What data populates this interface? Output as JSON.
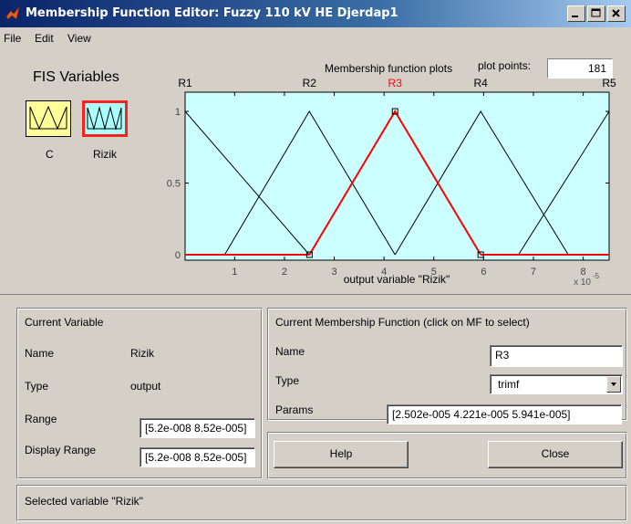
{
  "window": {
    "title": "Membership Function Editor: Fuzzy 110 kV HE Djerdap1",
    "icon": "matlab-icon",
    "buttons": [
      "minimize",
      "maximize",
      "close"
    ]
  },
  "menu": {
    "items": [
      "File",
      "Edit",
      "View"
    ]
  },
  "fis_variables": {
    "title": "FIS Variables",
    "variables": [
      {
        "name": "C",
        "selected": false,
        "fill": "#ffff99"
      },
      {
        "name": "Rizik",
        "selected": true,
        "fill": "#aaffff"
      }
    ],
    "selected_border": "#ff2020"
  },
  "plot_header": {
    "title": "Membership function plots",
    "plot_points_label": "plot points:",
    "plot_points_value": "181"
  },
  "chart_data": {
    "type": "line",
    "xlabel": "output variable \"Rizik\"",
    "x_multiplier": "x 10",
    "x_multiplier_exponent": "-5",
    "xlim": [
      0.0052,
      8.52
    ],
    "ylim": [
      0,
      1
    ],
    "x_ticks": [
      "1",
      "2",
      "3",
      "4",
      "5",
      "6",
      "7",
      "8"
    ],
    "y_ticks": [
      "0",
      "0.5",
      "1"
    ],
    "background": "#ccffff",
    "line_color": "#000000",
    "selected_color": "#ff0000",
    "series": [
      {
        "name": "R1",
        "x": [
          0.0052,
          0.0052,
          2.5
        ],
        "y": [
          0,
          1,
          0
        ]
      },
      {
        "name": "R2",
        "x": [
          0.8,
          2.5,
          4.221
        ],
        "y": [
          0,
          1,
          0
        ]
      },
      {
        "name": "R3",
        "x": [
          2.502,
          4.221,
          5.941
        ],
        "y": [
          0,
          1,
          0
        ],
        "selected": true
      },
      {
        "name": "R4",
        "x": [
          4.221,
          5.941,
          7.7
        ],
        "y": [
          0,
          1,
          0
        ]
      },
      {
        "name": "R5",
        "x": [
          6.7,
          8.52,
          8.52
        ],
        "y": [
          0,
          1,
          0
        ]
      }
    ]
  },
  "current_variable": {
    "title": "Current Variable",
    "name_label": "Name",
    "name_value": "Rizik",
    "type_label": "Type",
    "type_value": "output",
    "range_label": "Range",
    "range_value": "[5.2e-008 8.52e-005]",
    "display_range_label": "Display Range",
    "display_range_value": "[5.2e-008 8.52e-005]"
  },
  "current_mf": {
    "title": "Current Membership Function (click on MF to select)",
    "name_label": "Name",
    "name_value": "R3",
    "type_label": "Type",
    "type_value": "trimf",
    "params_label": "Params",
    "params_value": "[2.502e-005 4.221e-005 5.941e-005]"
  },
  "buttons": {
    "help": "Help",
    "close": "Close"
  },
  "status": {
    "text": "Selected variable \"Rizik\""
  }
}
